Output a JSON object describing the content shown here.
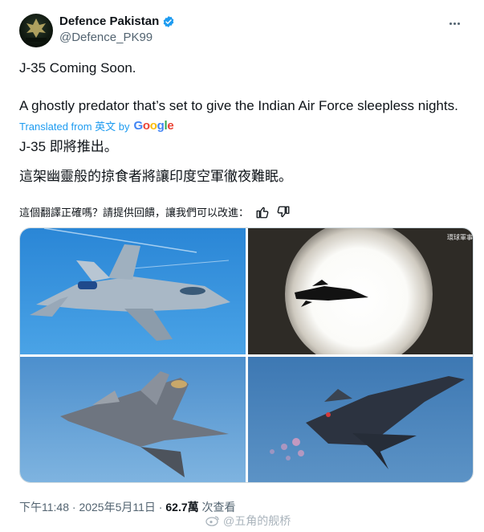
{
  "author": {
    "name": "Defence Pakistan",
    "handle": "@Defence_PK99",
    "avatar_text": "DEFENCE"
  },
  "tweet": {
    "line1": "J-35 Coming Soon.",
    "line2": "A ghostly predator that’s set to give the Indian Air Force sleepless nights.",
    "translated_label": "Translated from 英文 by",
    "translated_service": "Google",
    "translated_line1": "J-35 即將推出。",
    "translated_line2": "這架幽靈般的掠食者將讓印度空軍徹夜難眠。"
  },
  "feedback": {
    "prompt": "這個翻譯正確嗎？請提供回饋，讓我們可以改進："
  },
  "media": {
    "tr_watermark": "環球軍事 Youth"
  },
  "meta": {
    "time": "下午11:48",
    "separator": " · ",
    "date": "2025年5月11日",
    "views_count": "62.7萬",
    "views_label": " 次查看"
  },
  "watermark": {
    "text": "@五角的舰桥"
  },
  "colors": {
    "accent": "#1d9bf0",
    "verified": "#1d9bf0",
    "muted": "#536471"
  },
  "icons": [
    "verified-badge-icon",
    "more-options-icon",
    "thumbs-up-icon",
    "thumbs-down-icon",
    "weibo-icon"
  ]
}
